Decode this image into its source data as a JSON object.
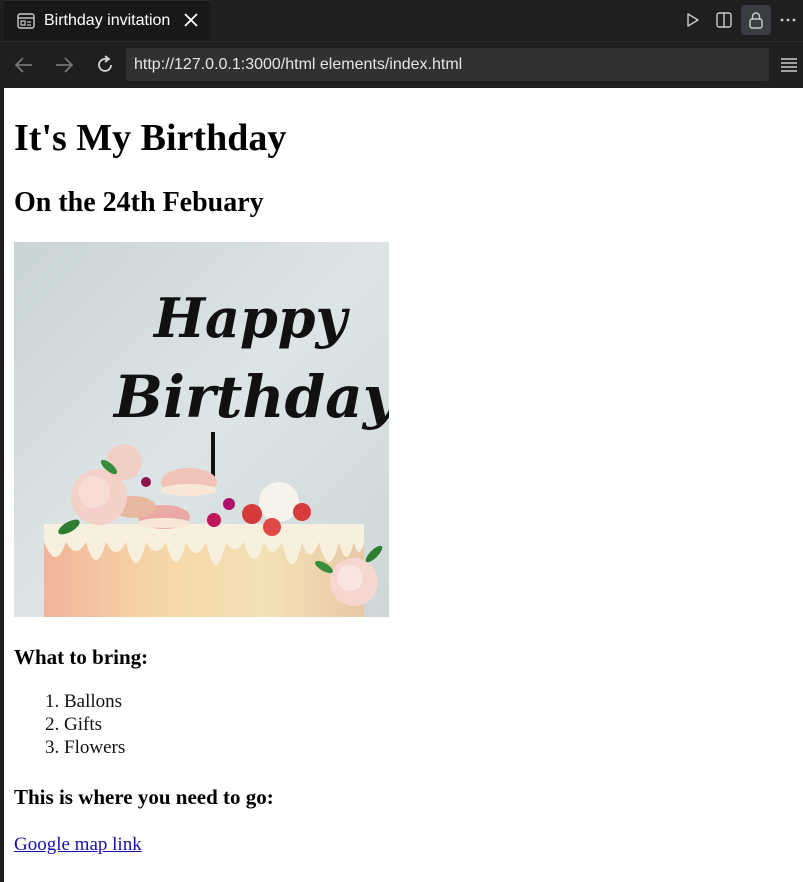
{
  "tab": {
    "title": "Birthday invitation"
  },
  "nav": {
    "url": "http://127.0.0.1:3000/html elements/index.html"
  },
  "page": {
    "heading": "It's My Birthday",
    "subheading": "On the 24th Febuary",
    "cake_text": [
      "Happy",
      "Birthday"
    ],
    "bring_heading": "What to bring:",
    "bring_items": [
      "Ballons",
      "Gifts",
      "Flowers"
    ],
    "go_heading": "This is where you need to go:",
    "map_link": "Google map link"
  },
  "colors": {
    "chrome_bg": "#1f1f1f",
    "tab_text": "#ffffff",
    "link": "#1a0dab"
  },
  "icons": {
    "tab": "page-icon",
    "close": "close-icon",
    "run": "play-icon",
    "split": "split-editor-icon",
    "lock": "lock-icon",
    "more": "ellipsis-icon",
    "back": "arrow-left-icon",
    "forward": "arrow-right-icon",
    "reload": "reload-icon",
    "menu": "menu-icon"
  }
}
